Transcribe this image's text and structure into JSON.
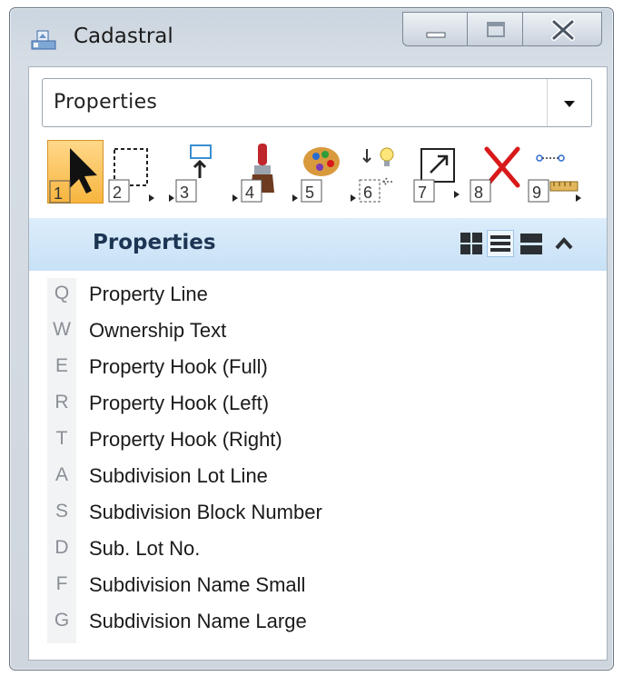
{
  "window": {
    "title": "Cadastral"
  },
  "dropdown": {
    "value": "Properties"
  },
  "toolbar": {
    "tools": [
      {
        "number": "1",
        "icon": "select-arrow-icon"
      },
      {
        "number": "2",
        "icon": "dashed-selection-icon"
      },
      {
        "number": "3",
        "icon": "place-text-icon"
      },
      {
        "number": "4",
        "icon": "paint-brush-icon"
      },
      {
        "number": "5",
        "icon": "palette-icon"
      },
      {
        "number": "6",
        "icon": "lightbulb-icon"
      },
      {
        "number": "7",
        "icon": "scale-arrow-icon"
      },
      {
        "number": "8",
        "icon": "delete-x-icon"
      },
      {
        "number": "9",
        "icon": "measure-icon"
      }
    ]
  },
  "section": {
    "title": "Properties"
  },
  "items": [
    {
      "key": "Q",
      "label": "Property Line"
    },
    {
      "key": "W",
      "label": "Ownership Text"
    },
    {
      "key": "E",
      "label": "Property Hook (Full)"
    },
    {
      "key": "R",
      "label": "Property Hook (Left)"
    },
    {
      "key": "T",
      "label": "Property Hook (Right)"
    },
    {
      "key": "A",
      "label": "Subdivision Lot Line"
    },
    {
      "key": "S",
      "label": "Subdivision Block Number"
    },
    {
      "key": "D",
      "label": "Sub. Lot No."
    },
    {
      "key": "F",
      "label": "Subdivision Name Small"
    },
    {
      "key": "G",
      "label": "Subdivision Name Large"
    }
  ],
  "colors": {
    "active_tool": "#f7b53f",
    "section_header": "#c8e1f6",
    "delete_red": "#d8191b"
  }
}
